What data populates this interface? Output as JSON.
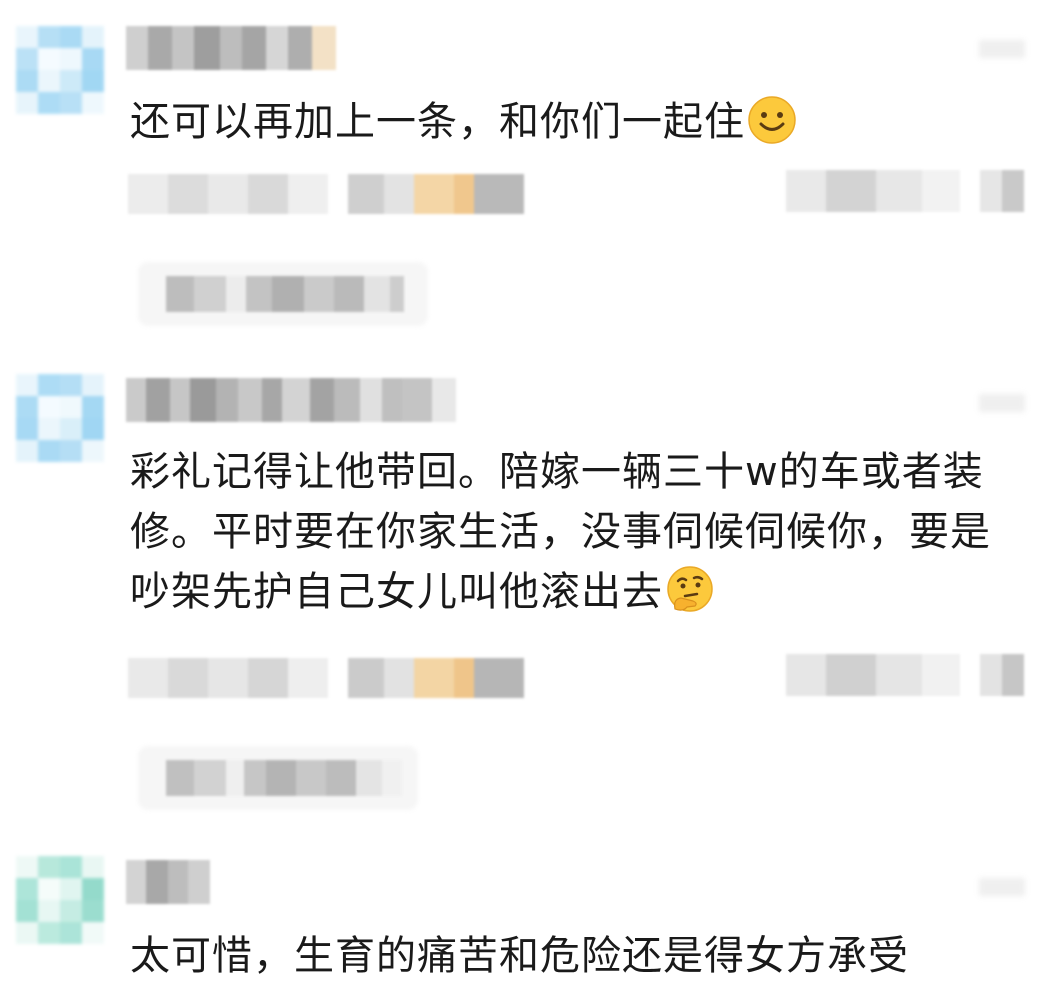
{
  "comments": [
    {
      "text": "还可以再加上一条，和你们一起住",
      "emoji": "smiling-face-emoji",
      "avatar_colors": [
        "#bfe4f7",
        "#a9dbf5",
        "#9fd7f4",
        "#c8e9f8"
      ]
    },
    {
      "text": "彩礼记得让他带回。陪嫁一辆三十w的车或者装修。平时要在你家生活，没事伺候伺候你，要是吵架先护自己女儿叫他滚出去",
      "emoji": "thinking-face-emoji",
      "avatar_colors": [
        "#b7dff6",
        "#a2d8f4",
        "#9bd5f3",
        "#c5e7f8"
      ]
    },
    {
      "text": "太可惜，生育的痛苦和危险还是得女方承受",
      "emoji": "",
      "avatar_colors": [
        "#b9ead9",
        "#8fd9c9",
        "#a7e6df",
        "#d4f3ee"
      ]
    }
  ],
  "colors": {
    "text": "#1a1a1a",
    "pixel_gray": "#b5b5b5",
    "pixel_light": "#e2e2e2",
    "pixel_orange": "#f2d3a3",
    "reply_bg": "#f6f6f6"
  }
}
